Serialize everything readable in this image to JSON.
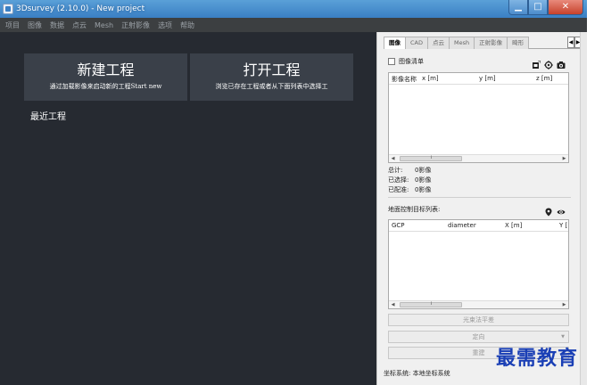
{
  "window": {
    "title": "3Dsurvey (2.10.0) - New project",
    "controls": {
      "minimize": "▁",
      "maximize": "□",
      "close": "✕"
    }
  },
  "menu": [
    "项目",
    "图像",
    "数据",
    "点云",
    "Mesh",
    "正射影像",
    "选项",
    "帮助"
  ],
  "start": {
    "new_project": {
      "title": "新建工程",
      "subtitle": "通过加载影像来启动新的工程Start new"
    },
    "open_project": {
      "title": "打开工程",
      "subtitle": "浏览已存在工程或者从下面列表中选择工"
    },
    "recent_label": "最近工程"
  },
  "panel": {
    "tabs": [
      "图像",
      "CAD",
      "点云",
      "Mesh",
      "正射影像",
      "畸形"
    ],
    "active_tab": "图像",
    "tab_arrows": [
      "◀",
      "▶"
    ],
    "image_list_label": "图像清单",
    "image_table": {
      "columns": [
        "影像名称",
        "x [m]",
        "y [m]",
        "z [m]"
      ]
    },
    "stats": [
      {
        "label": "总计:",
        "value": "0影像"
      },
      {
        "label": "已选择:",
        "value": "0影像"
      },
      {
        "label": "已配准:",
        "value": "0影像"
      }
    ],
    "gcp_label": "地面控制目标列表:",
    "gcp_table": {
      "columns": [
        "GCP",
        "diameter",
        "X [m]",
        "Y ["
      ]
    },
    "scroll_arrows": {
      "left": "◀",
      "right": "▶"
    },
    "buttons": {
      "bundle": "光束法平差",
      "orient": "定向",
      "orient_dropdown": "▼",
      "rebuild": "重建"
    },
    "coord_system": "坐标系统:  本地坐标系统"
  },
  "watermark": "最需教育",
  "colors": {
    "dark_bg": "#262a31",
    "tile_bg": "#3a4049",
    "watermark": "#1a3fb5"
  }
}
